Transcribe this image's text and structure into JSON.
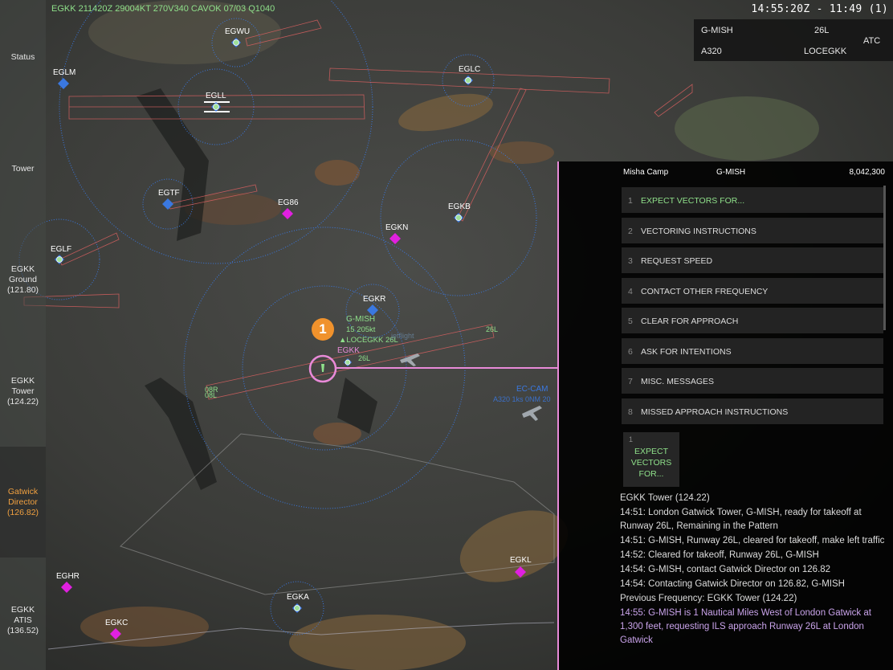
{
  "metar": "EGKK 211420Z 29004KT 270V340 CAVOK 07/03 Q1040",
  "clock": "14:55:20Z - 11:49 (1)",
  "sidebar": {
    "items": [
      {
        "label": "Status"
      },
      {
        "label": "Tower"
      },
      {
        "label": "EGKK Ground (121.80)"
      },
      {
        "label": "EGKK Tower (124.22)"
      },
      {
        "label": "Gatwick Director (126.82)"
      },
      {
        "label": "EGKK ATIS (136.52)"
      }
    ]
  },
  "strip": {
    "callsign": "G-MISH",
    "runway": "26L",
    "type": "A320",
    "route": "LOCEGKK",
    "role": "ATC"
  },
  "map": {
    "airports": [
      "EGWU",
      "EGLM",
      "EGLL",
      "EGLC",
      "EGTF",
      "EG86",
      "EGKB",
      "EGKN",
      "EGLF",
      "EGKR",
      "EGKK",
      "EGKL",
      "EGHR",
      "EGKA",
      "EGKC"
    ],
    "runway_labels": [
      "26L",
      "08R",
      "08L",
      "26L"
    ],
    "aircraft_tag": {
      "callsign": "G-MISH",
      "data": "15 205kt",
      "clearance": "LOCEGKK 26L",
      "other": "EC-CAM",
      "other_data": "A320 1ks 0NM 20",
      "faint": "jetflight"
    },
    "badge": "1",
    "colors": {
      "rings": "#3a78e0",
      "corridor": "#d86060",
      "accent": "#e88ad8",
      "green": "#8fe08a"
    }
  },
  "panel": {
    "pilot": "Misha Camp",
    "callsign": "G-MISH",
    "score": "8,042,300",
    "menu": [
      {
        "num": "1",
        "label": "EXPECT VECTORS FOR..."
      },
      {
        "num": "2",
        "label": "VECTORING INSTRUCTIONS"
      },
      {
        "num": "3",
        "label": "REQUEST SPEED"
      },
      {
        "num": "4",
        "label": "CONTACT OTHER FREQUENCY"
      },
      {
        "num": "5",
        "label": "CLEAR FOR APPROACH"
      },
      {
        "num": "6",
        "label": "ASK FOR INTENTIONS"
      },
      {
        "num": "7",
        "label": "MISC. MESSAGES"
      },
      {
        "num": "8",
        "label": "MISSED APPROACH INSTRUCTIONS"
      }
    ],
    "quick": {
      "num": "1",
      "label": "EXPECT VECTORS FOR..."
    },
    "log": [
      "EGKK Tower (124.22)",
      "14:51: London Gatwick Tower, G-MISH, ready for takeoff at Runway 26L, Remaining in the Pattern",
      "14:51: G-MISH, Runway 26L, cleared for takeoff, make left traffic",
      "14:52: Cleared for takeoff, Runway 26L, G-MISH",
      "14:54: G-MISH, contact Gatwick Director on 126.82",
      "14:54: Contacting Gatwick Director on 126.82, G-MISH",
      "Previous Frequency: EGKK Tower (124.22)",
      "14:55: G-MISH is 1 Nautical Miles West of London Gatwick at 1,300 feet, requesting ILS approach Runway 26L at London Gatwick"
    ]
  }
}
